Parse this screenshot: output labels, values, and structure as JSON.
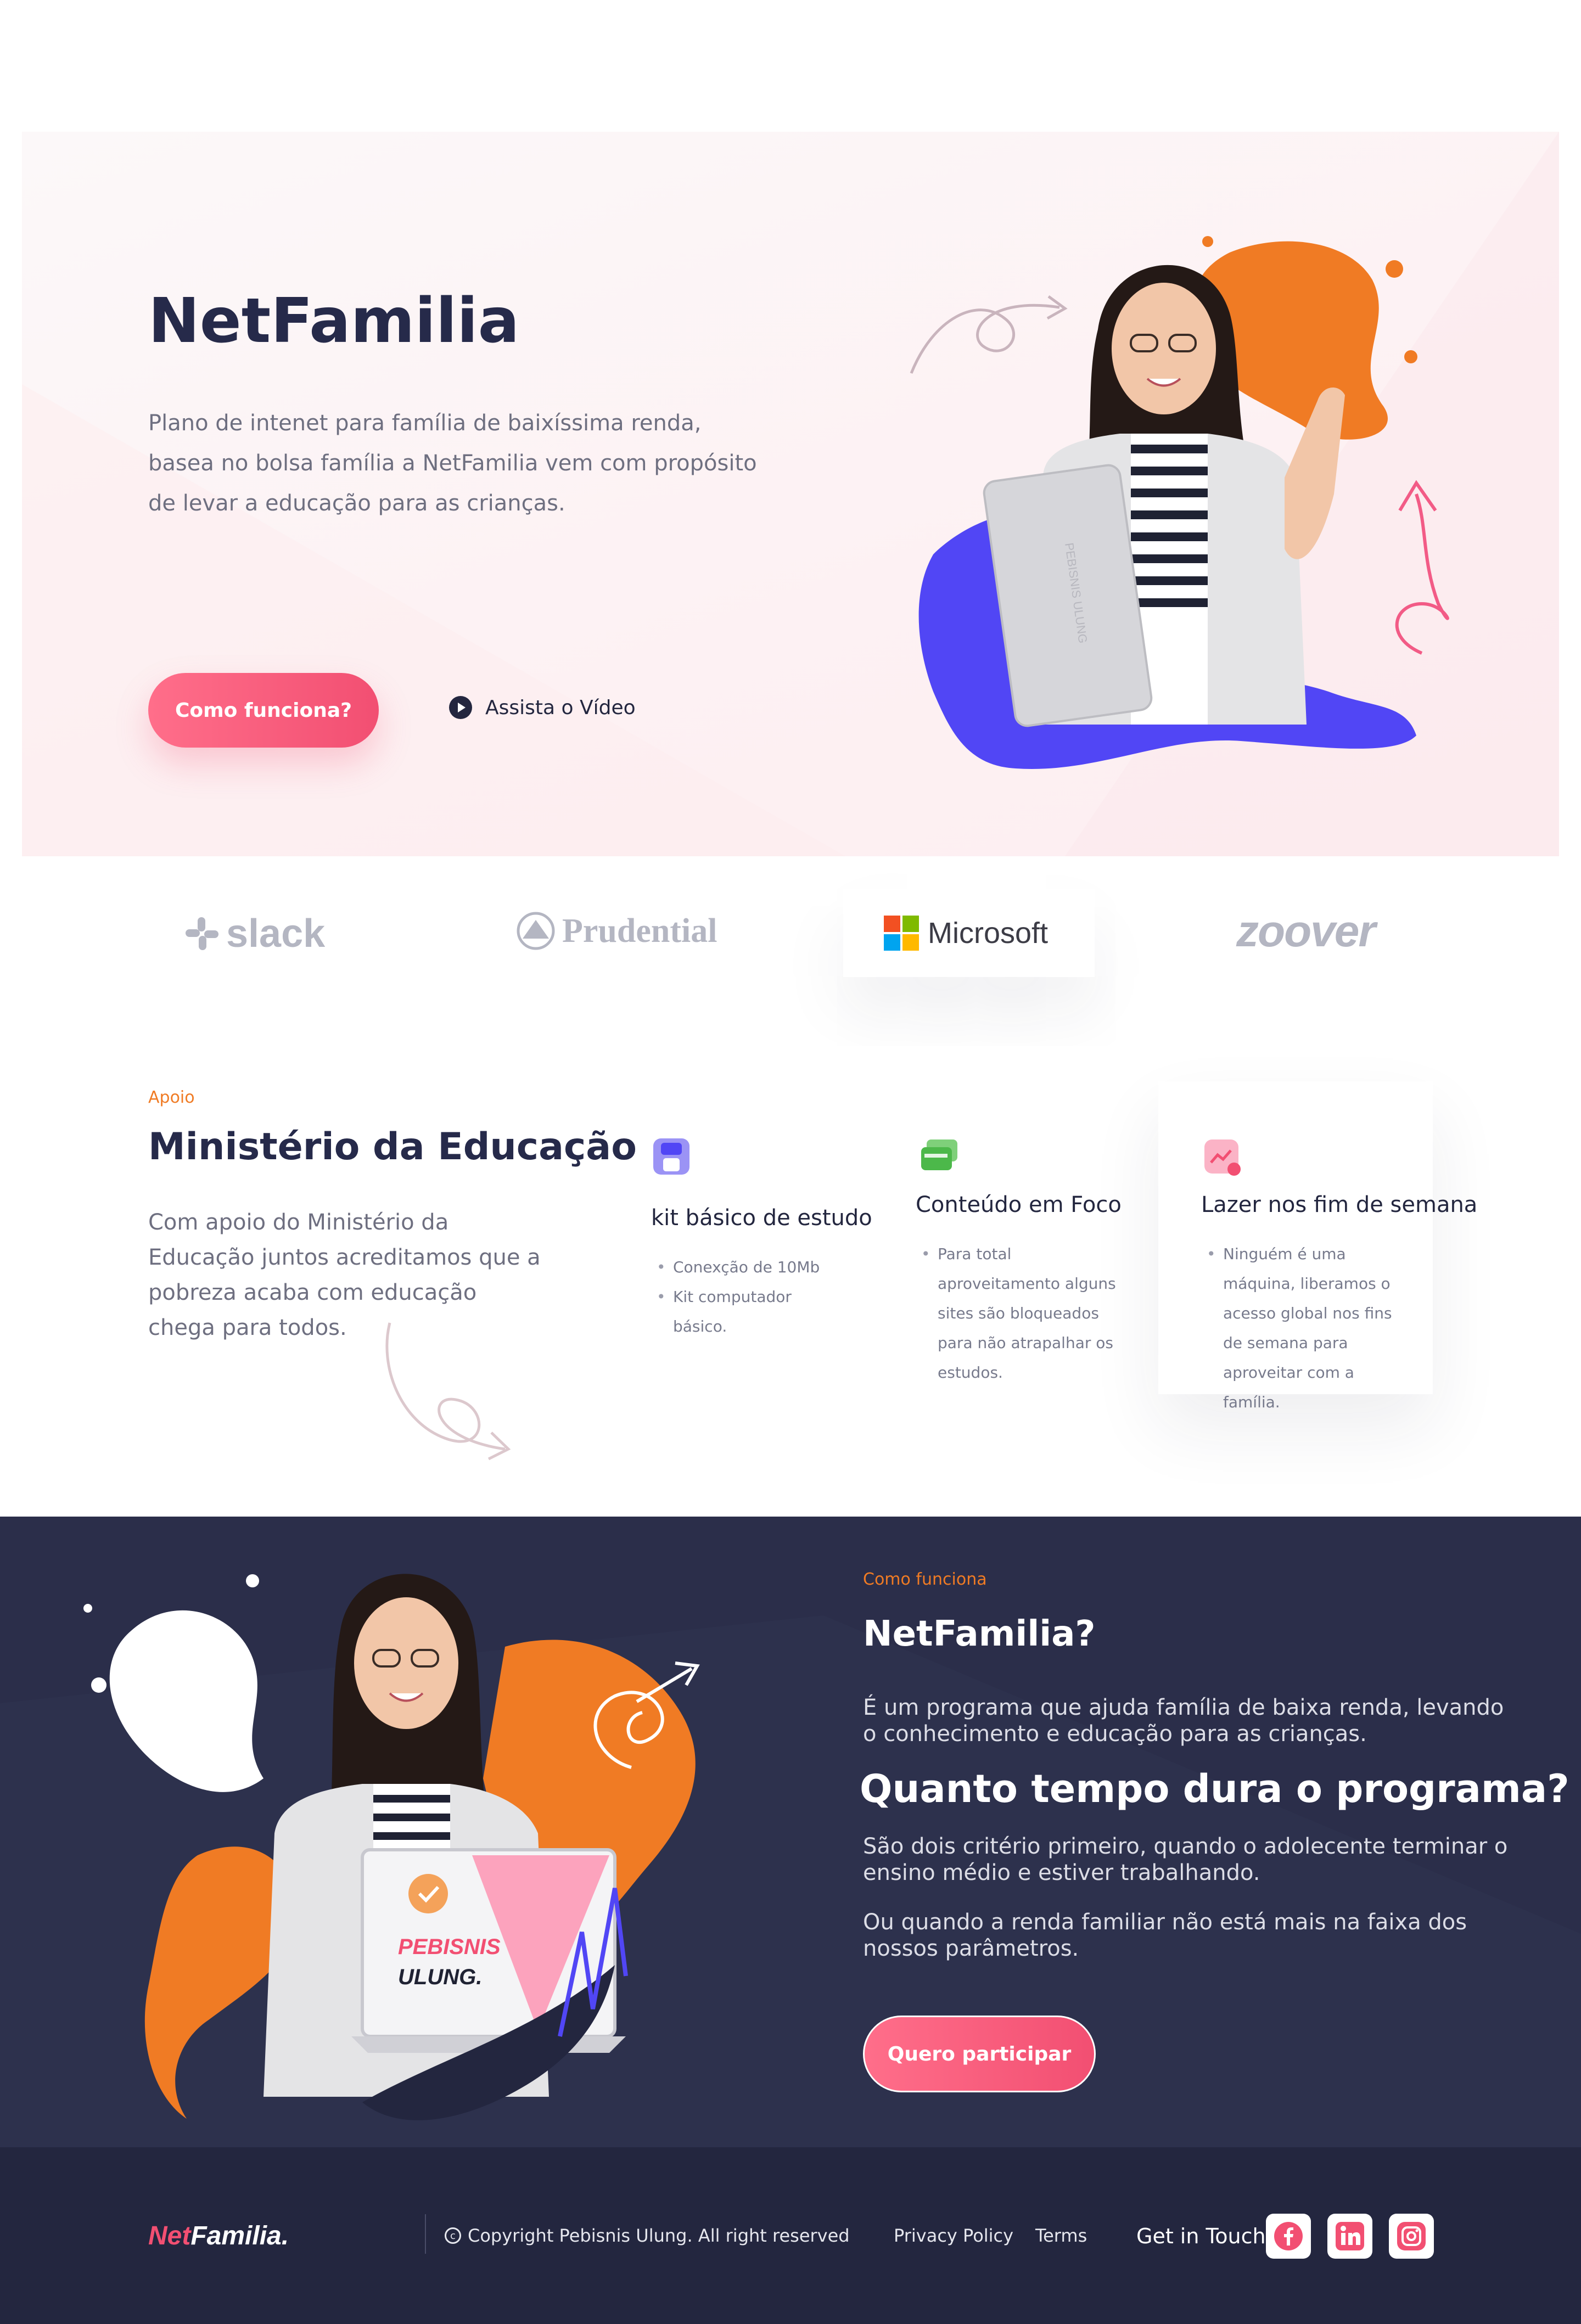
{
  "hero": {
    "title": "NetFamilia",
    "description": "Plano de intenet para família de baixíssima renda, basea no bolsa família a NetFamilia vem com propósito de levar a educação para as crianças.",
    "cta_label": "Como funciona?",
    "video_label": "Assista o Vídeo",
    "laptop_text": "PEBISNIS ULUNG"
  },
  "partners": {
    "items": [
      {
        "label": "slack"
      },
      {
        "label": "Prudential"
      },
      {
        "label": "Microsoft"
      },
      {
        "label": "zoover"
      }
    ]
  },
  "support": {
    "tag": "Apoio",
    "title": "Ministério da Educação",
    "description": "Com apoio do Ministério da Educação juntos acreditamos que a pobreza acaba com educação chega para todos.",
    "features": [
      {
        "icon": "store-icon",
        "title": "kit básico de estudo",
        "items": [
          "Conexção de 10Mb",
          "Kit computador básico."
        ]
      },
      {
        "icon": "card-icon",
        "title": "Conteúdo em Foco",
        "items": [
          "Para total aproveitamento alguns sites são bloqueados para não atrapalhar os estudos."
        ]
      },
      {
        "icon": "chart-icon",
        "title": "Lazer nos fim de semana",
        "items": [
          "Ninguém é uma máquina, liberamos o acesso global nos fins de semana para aproveitar com a família."
        ]
      }
    ]
  },
  "how": {
    "tag": "Como funciona",
    "title": "NetFamilia?",
    "p1": "É um programa que ajuda família de baixa renda, levando o conhecimento e educação para as crianças.",
    "question": "Quanto tempo dura o programa?",
    "p2": "São dois critério primeiro, quando o adolecente terminar o ensino médio e estiver trabalhando.",
    "p3": "Ou quando a renda familiar não está mais na faixa dos nossos parâmetros.",
    "cta_label": "Quero participar",
    "laptop_line1": "PEBISNIS",
    "laptop_line2": "ULUNG."
  },
  "footer": {
    "logo_net": "Net",
    "logo_familia": "Familia.",
    "copyright": "Copyright Pebisnis Ulung. All right reserved",
    "privacy": "Privacy Policy",
    "terms": "Terms",
    "get_in_touch": "Get in Touch",
    "social": [
      "facebook-icon",
      "linkedin-icon",
      "instagram-icon"
    ]
  },
  "colors": {
    "accent": "#f24f72",
    "orange": "#f07b24",
    "navy": "#2b2e4a",
    "purple": "#5146f5"
  }
}
